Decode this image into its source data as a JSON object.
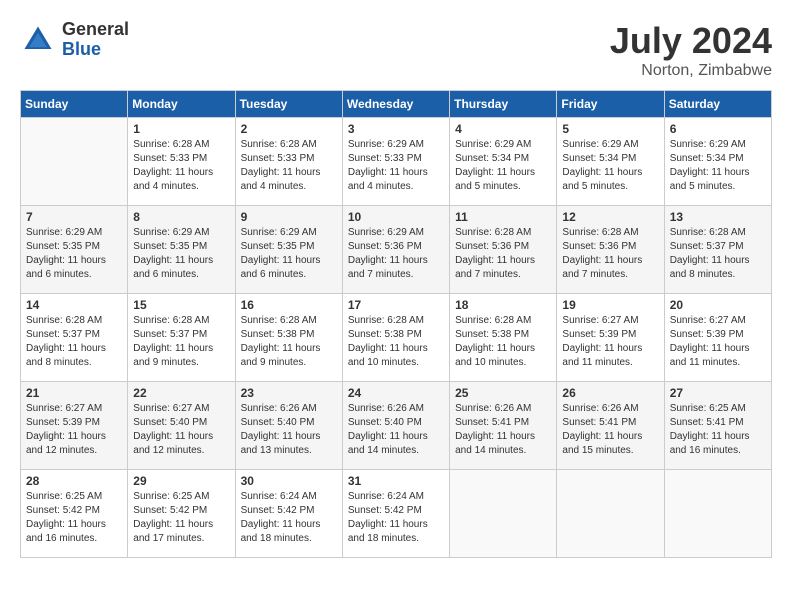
{
  "header": {
    "logo": {
      "general": "General",
      "blue": "Blue"
    },
    "title": "July 2024",
    "location": "Norton, Zimbabwe"
  },
  "calendar": {
    "days_of_week": [
      "Sunday",
      "Monday",
      "Tuesday",
      "Wednesday",
      "Thursday",
      "Friday",
      "Saturday"
    ],
    "weeks": [
      [
        {
          "day": "",
          "content": ""
        },
        {
          "day": "1",
          "content": "Sunrise: 6:28 AM\nSunset: 5:33 PM\nDaylight: 11 hours\nand 4 minutes."
        },
        {
          "day": "2",
          "content": "Sunrise: 6:28 AM\nSunset: 5:33 PM\nDaylight: 11 hours\nand 4 minutes."
        },
        {
          "day": "3",
          "content": "Sunrise: 6:29 AM\nSunset: 5:33 PM\nDaylight: 11 hours\nand 4 minutes."
        },
        {
          "day": "4",
          "content": "Sunrise: 6:29 AM\nSunset: 5:34 PM\nDaylight: 11 hours\nand 5 minutes."
        },
        {
          "day": "5",
          "content": "Sunrise: 6:29 AM\nSunset: 5:34 PM\nDaylight: 11 hours\nand 5 minutes."
        },
        {
          "day": "6",
          "content": "Sunrise: 6:29 AM\nSunset: 5:34 PM\nDaylight: 11 hours\nand 5 minutes."
        }
      ],
      [
        {
          "day": "7",
          "content": "Sunrise: 6:29 AM\nSunset: 5:35 PM\nDaylight: 11 hours\nand 6 minutes."
        },
        {
          "day": "8",
          "content": "Sunrise: 6:29 AM\nSunset: 5:35 PM\nDaylight: 11 hours\nand 6 minutes."
        },
        {
          "day": "9",
          "content": "Sunrise: 6:29 AM\nSunset: 5:35 PM\nDaylight: 11 hours\nand 6 minutes."
        },
        {
          "day": "10",
          "content": "Sunrise: 6:29 AM\nSunset: 5:36 PM\nDaylight: 11 hours\nand 7 minutes."
        },
        {
          "day": "11",
          "content": "Sunrise: 6:28 AM\nSunset: 5:36 PM\nDaylight: 11 hours\nand 7 minutes."
        },
        {
          "day": "12",
          "content": "Sunrise: 6:28 AM\nSunset: 5:36 PM\nDaylight: 11 hours\nand 7 minutes."
        },
        {
          "day": "13",
          "content": "Sunrise: 6:28 AM\nSunset: 5:37 PM\nDaylight: 11 hours\nand 8 minutes."
        }
      ],
      [
        {
          "day": "14",
          "content": "Sunrise: 6:28 AM\nSunset: 5:37 PM\nDaylight: 11 hours\nand 8 minutes."
        },
        {
          "day": "15",
          "content": "Sunrise: 6:28 AM\nSunset: 5:37 PM\nDaylight: 11 hours\nand 9 minutes."
        },
        {
          "day": "16",
          "content": "Sunrise: 6:28 AM\nSunset: 5:38 PM\nDaylight: 11 hours\nand 9 minutes."
        },
        {
          "day": "17",
          "content": "Sunrise: 6:28 AM\nSunset: 5:38 PM\nDaylight: 11 hours\nand 10 minutes."
        },
        {
          "day": "18",
          "content": "Sunrise: 6:28 AM\nSunset: 5:38 PM\nDaylight: 11 hours\nand 10 minutes."
        },
        {
          "day": "19",
          "content": "Sunrise: 6:27 AM\nSunset: 5:39 PM\nDaylight: 11 hours\nand 11 minutes."
        },
        {
          "day": "20",
          "content": "Sunrise: 6:27 AM\nSunset: 5:39 PM\nDaylight: 11 hours\nand 11 minutes."
        }
      ],
      [
        {
          "day": "21",
          "content": "Sunrise: 6:27 AM\nSunset: 5:39 PM\nDaylight: 11 hours\nand 12 minutes."
        },
        {
          "day": "22",
          "content": "Sunrise: 6:27 AM\nSunset: 5:40 PM\nDaylight: 11 hours\nand 12 minutes."
        },
        {
          "day": "23",
          "content": "Sunrise: 6:26 AM\nSunset: 5:40 PM\nDaylight: 11 hours\nand 13 minutes."
        },
        {
          "day": "24",
          "content": "Sunrise: 6:26 AM\nSunset: 5:40 PM\nDaylight: 11 hours\nand 14 minutes."
        },
        {
          "day": "25",
          "content": "Sunrise: 6:26 AM\nSunset: 5:41 PM\nDaylight: 11 hours\nand 14 minutes."
        },
        {
          "day": "26",
          "content": "Sunrise: 6:26 AM\nSunset: 5:41 PM\nDaylight: 11 hours\nand 15 minutes."
        },
        {
          "day": "27",
          "content": "Sunrise: 6:25 AM\nSunset: 5:41 PM\nDaylight: 11 hours\nand 16 minutes."
        }
      ],
      [
        {
          "day": "28",
          "content": "Sunrise: 6:25 AM\nSunset: 5:42 PM\nDaylight: 11 hours\nand 16 minutes."
        },
        {
          "day": "29",
          "content": "Sunrise: 6:25 AM\nSunset: 5:42 PM\nDaylight: 11 hours\nand 17 minutes."
        },
        {
          "day": "30",
          "content": "Sunrise: 6:24 AM\nSunset: 5:42 PM\nDaylight: 11 hours\nand 18 minutes."
        },
        {
          "day": "31",
          "content": "Sunrise: 6:24 AM\nSunset: 5:42 PM\nDaylight: 11 hours\nand 18 minutes."
        },
        {
          "day": "",
          "content": ""
        },
        {
          "day": "",
          "content": ""
        },
        {
          "day": "",
          "content": ""
        }
      ]
    ]
  }
}
